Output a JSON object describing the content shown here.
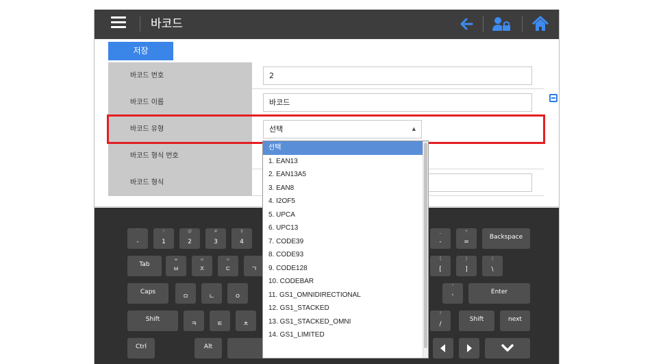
{
  "header": {
    "title": "바코드",
    "icons": [
      "menu-icon",
      "arrow-left-icon",
      "user-lock-icon",
      "home-icon"
    ],
    "accent": "#3d8bf0"
  },
  "toolbar": {
    "save_label": "저장"
  },
  "form": {
    "barcode_number": {
      "label": "바코드 번호",
      "value": "2"
    },
    "barcode_name": {
      "label": "바코드 이름",
      "value": "바코드"
    },
    "barcode_type": {
      "label": "바코드 유형",
      "value": "선택"
    },
    "barcode_format_number": {
      "label": "바코드 형식 번호"
    },
    "barcode_format": {
      "label": "바코드 형식"
    }
  },
  "dropdown": {
    "options": [
      "선택",
      "1. EAN13",
      "2. EAN13A5",
      "3. EAN8",
      "4. I2OF5",
      "5. UPCA",
      "6. UPC13",
      "7. CODE39",
      "8. CODE93",
      "9. CODE128",
      "10. CODEBAR",
      "11. GS1_OMNIDIRECTIONAL",
      "12. GS1_STACKED",
      "13. GS1_STACKED_OMNI",
      "14. GS1_LIMITED"
    ]
  },
  "keyboard": {
    "row1": [
      {
        "main": "-",
        "sub": "`"
      },
      {
        "main": "1",
        "sub": "!"
      },
      {
        "main": "2",
        "sub": "@"
      },
      {
        "main": "3",
        "sub": "#"
      },
      {
        "main": "4",
        "sub": "$"
      }
    ],
    "row1_right": [
      {
        "main": "-",
        "sub": "_"
      },
      {
        "main": "=",
        "sub": "+"
      }
    ],
    "backspace": "Backspace",
    "tab": "Tab",
    "row2": [
      {
        "main": "ㅂ",
        "sub": "ㅃ"
      },
      {
        "main": "ㅈ",
        "sub": "ㅉ"
      },
      {
        "main": "ㄷ",
        "sub": "ㄸ"
      },
      {
        "main": "ㄱ",
        "sub": ""
      }
    ],
    "row2_right": [
      {
        "main": "[",
        "sub": "{"
      },
      {
        "main": "]",
        "sub": "}"
      },
      {
        "main": "\\",
        "sub": "|"
      }
    ],
    "caps": "Caps",
    "row3": [
      {
        "main": "ㅁ",
        "sub": ""
      },
      {
        "main": "ㄴ",
        "sub": ""
      },
      {
        "main": "ㅇ",
        "sub": ""
      }
    ],
    "row3_right": [
      {
        "main": "'",
        "sub": "\""
      }
    ],
    "enter": "Enter",
    "shift": "Shift",
    "row4": [
      {
        "main": "ㅋ",
        "sub": ""
      },
      {
        "main": "ㅌ",
        "sub": ""
      },
      {
        "main": "ㅊ",
        "sub": ""
      }
    ],
    "row4_right": [
      {
        "main": "/",
        "sub": "?"
      }
    ],
    "shift_right": "Shift",
    "next": "next",
    "ctrl": "Ctrl",
    "alt": "Alt"
  }
}
